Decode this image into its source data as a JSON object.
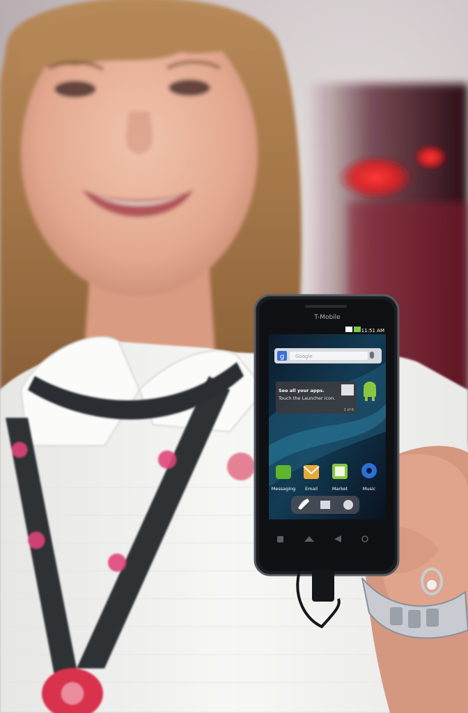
{
  "phone": {
    "carrier": "T-Mobile",
    "time": "11:51 AM",
    "search_placeholder": "Google",
    "tooltip_line1": "See all your apps.",
    "tooltip_line2": "Touch the Launcher icon.",
    "tooltip_page": "1 of 6",
    "apps": [
      {
        "label": "Messaging",
        "color": "#5fb52d",
        "icon": "messaging-icon"
      },
      {
        "label": "Email",
        "color": "#e9a93a",
        "icon": "email-icon"
      },
      {
        "label": "Market",
        "color": "#8cc63f",
        "icon": "market-icon"
      },
      {
        "label": "Music",
        "color": "#2f6fd6",
        "icon": "music-icon"
      }
    ]
  },
  "colors": {
    "shirt": "#f4f4f2",
    "lanyard": "#2e3236",
    "accent_pink": "#e0457a",
    "phone_body": "#1b1c20",
    "bokeh_red": "#e8282a"
  }
}
